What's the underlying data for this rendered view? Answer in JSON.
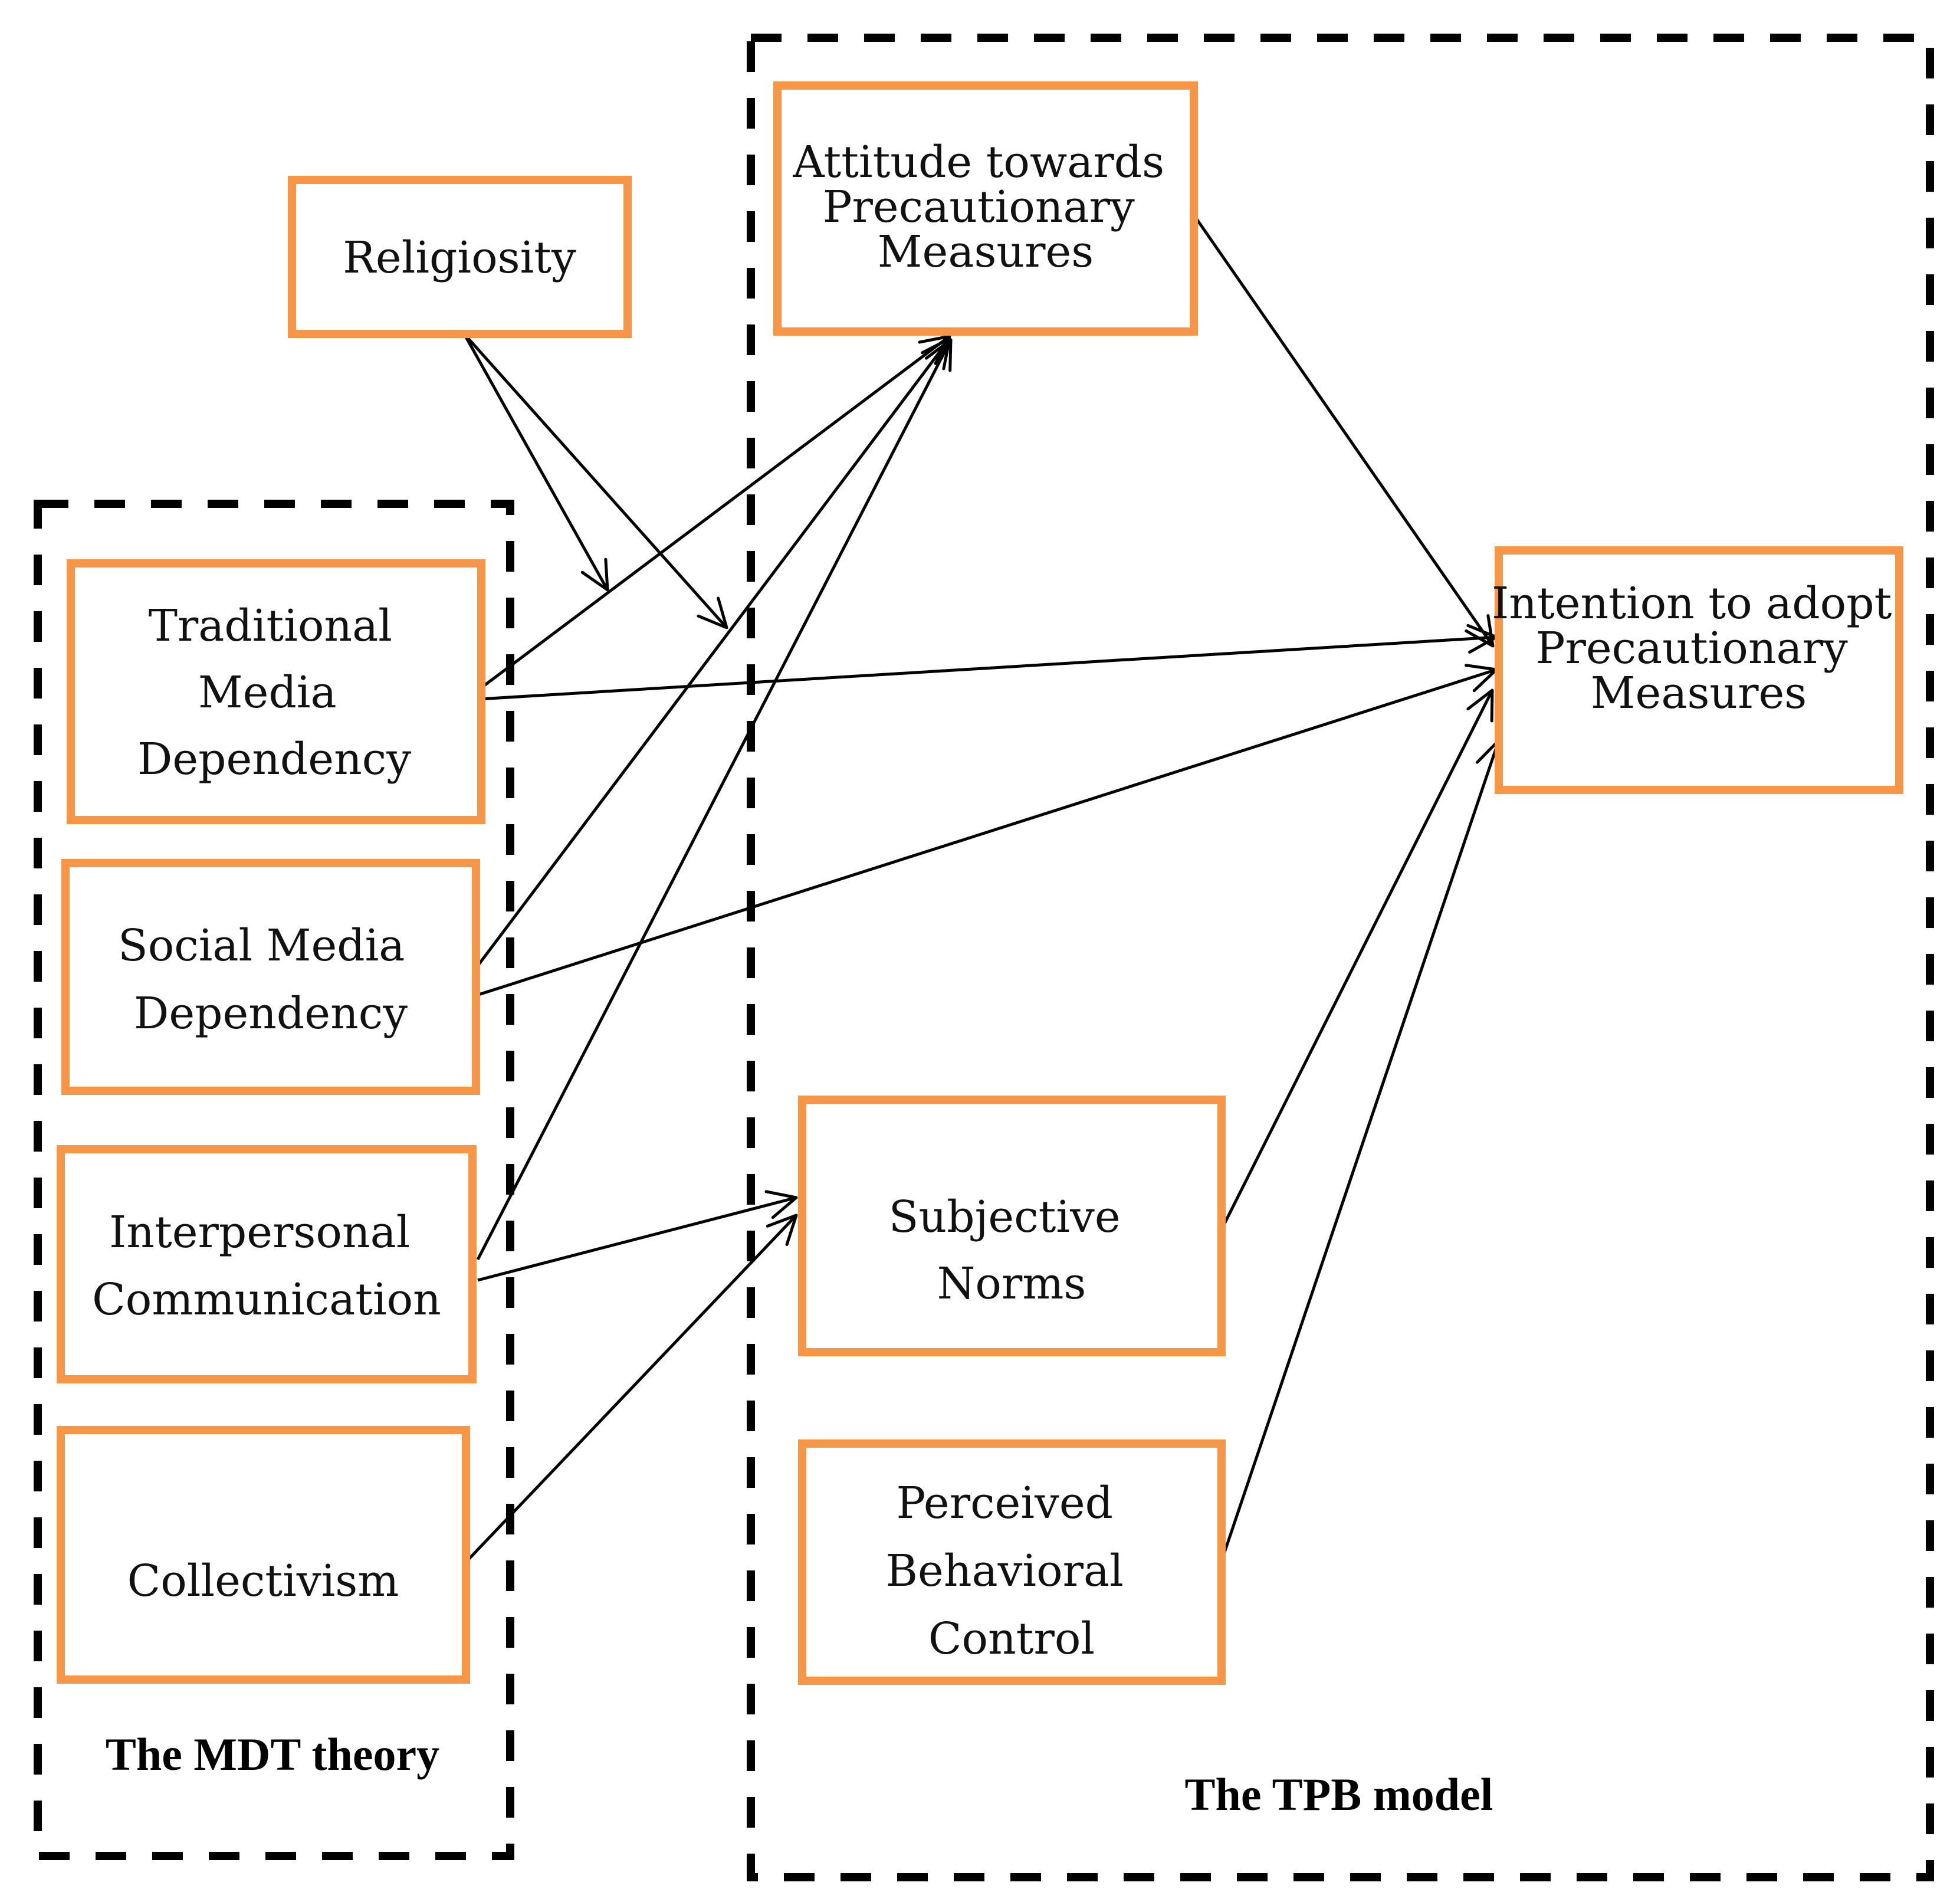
{
  "diagram": {
    "colors": {
      "node_border": "#F79646",
      "frame": "#000000",
      "arrow": "#000000",
      "background": "#FFFFFF"
    },
    "groups": [
      {
        "id": "tpb",
        "title": "The TPB model"
      },
      {
        "id": "mdt",
        "title": "The MDT theory"
      }
    ],
    "nodes": [
      {
        "id": "religiosity",
        "lines": [
          "Religiosity"
        ]
      },
      {
        "id": "attitude",
        "lines": [
          "Attitude towards",
          "Precautionary",
          "Measures"
        ]
      },
      {
        "id": "intention",
        "lines": [
          "Intention to adopt",
          "Precautionary",
          "Measures"
        ]
      },
      {
        "id": "traditional",
        "lines": [
          "Traditional",
          "Media",
          "Dependency"
        ]
      },
      {
        "id": "social",
        "lines": [
          "Social Media",
          "Dependency"
        ]
      },
      {
        "id": "interpersonal",
        "lines": [
          "Interpersonal",
          "Communication"
        ]
      },
      {
        "id": "collectivism",
        "lines": [
          "Collectivism"
        ]
      },
      {
        "id": "subjective",
        "lines": [
          "Subjective",
          "Norms"
        ]
      },
      {
        "id": "pbc",
        "lines": [
          "Perceived",
          "Behavioral",
          "Control"
        ]
      }
    ],
    "edges": [
      {
        "from": "religiosity",
        "to": "moderation-point-1",
        "kind": "moderation"
      },
      {
        "from": "religiosity",
        "to": "moderation-point-2",
        "kind": "moderation"
      },
      {
        "from": "traditional",
        "to": "attitude"
      },
      {
        "from": "traditional",
        "to": "intention"
      },
      {
        "from": "social",
        "to": "attitude"
      },
      {
        "from": "social",
        "to": "intention"
      },
      {
        "from": "interpersonal",
        "to": "attitude"
      },
      {
        "from": "interpersonal",
        "to": "subjective"
      },
      {
        "from": "collectivism",
        "to": "subjective"
      },
      {
        "from": "attitude",
        "to": "intention"
      },
      {
        "from": "subjective",
        "to": "intention"
      },
      {
        "from": "pbc",
        "to": "intention"
      }
    ]
  }
}
